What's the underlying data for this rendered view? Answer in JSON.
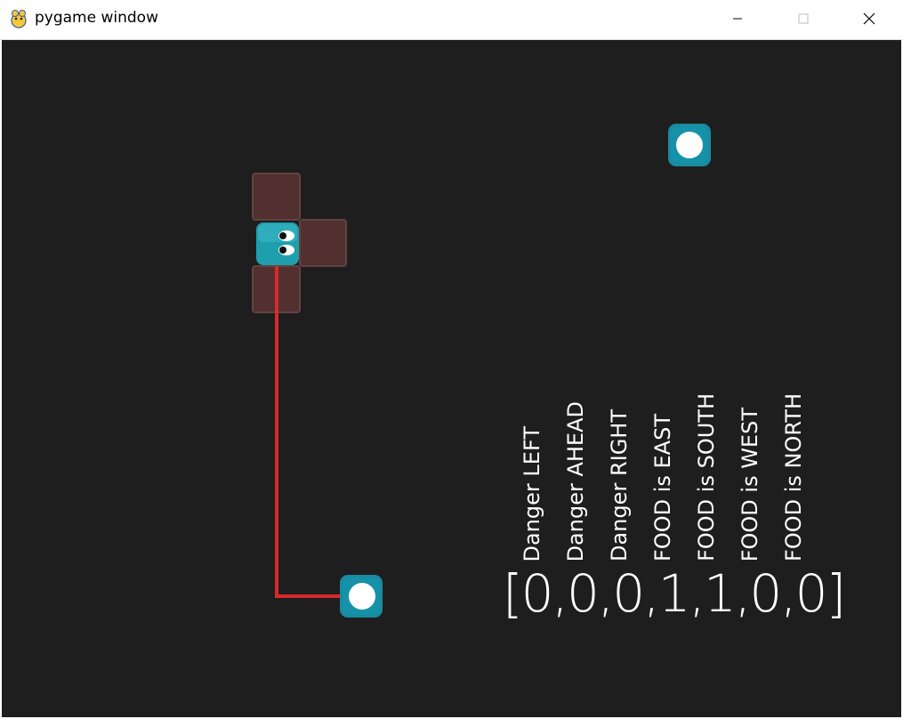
{
  "window": {
    "title": "pygame window",
    "controls": {
      "minimize": "minimize-icon",
      "maximize": "maximize-icon",
      "close": "close-icon"
    }
  },
  "game": {
    "background": "#1e1e1e",
    "path_color": "#d62a2a",
    "danger_cell_color": "#5a3432",
    "snake_color": "#1f9fae",
    "food_color": "#1a8aa0",
    "state_labels": [
      "Danger LEFT",
      "Danger AHEAD",
      "Danger RIGHT",
      "FOOD is EAST",
      "FOOD is SOUTH",
      "FOOD is WEST",
      "FOOD is NORTH"
    ],
    "state_vector": "[0,0,0,1,1,0,0]"
  }
}
